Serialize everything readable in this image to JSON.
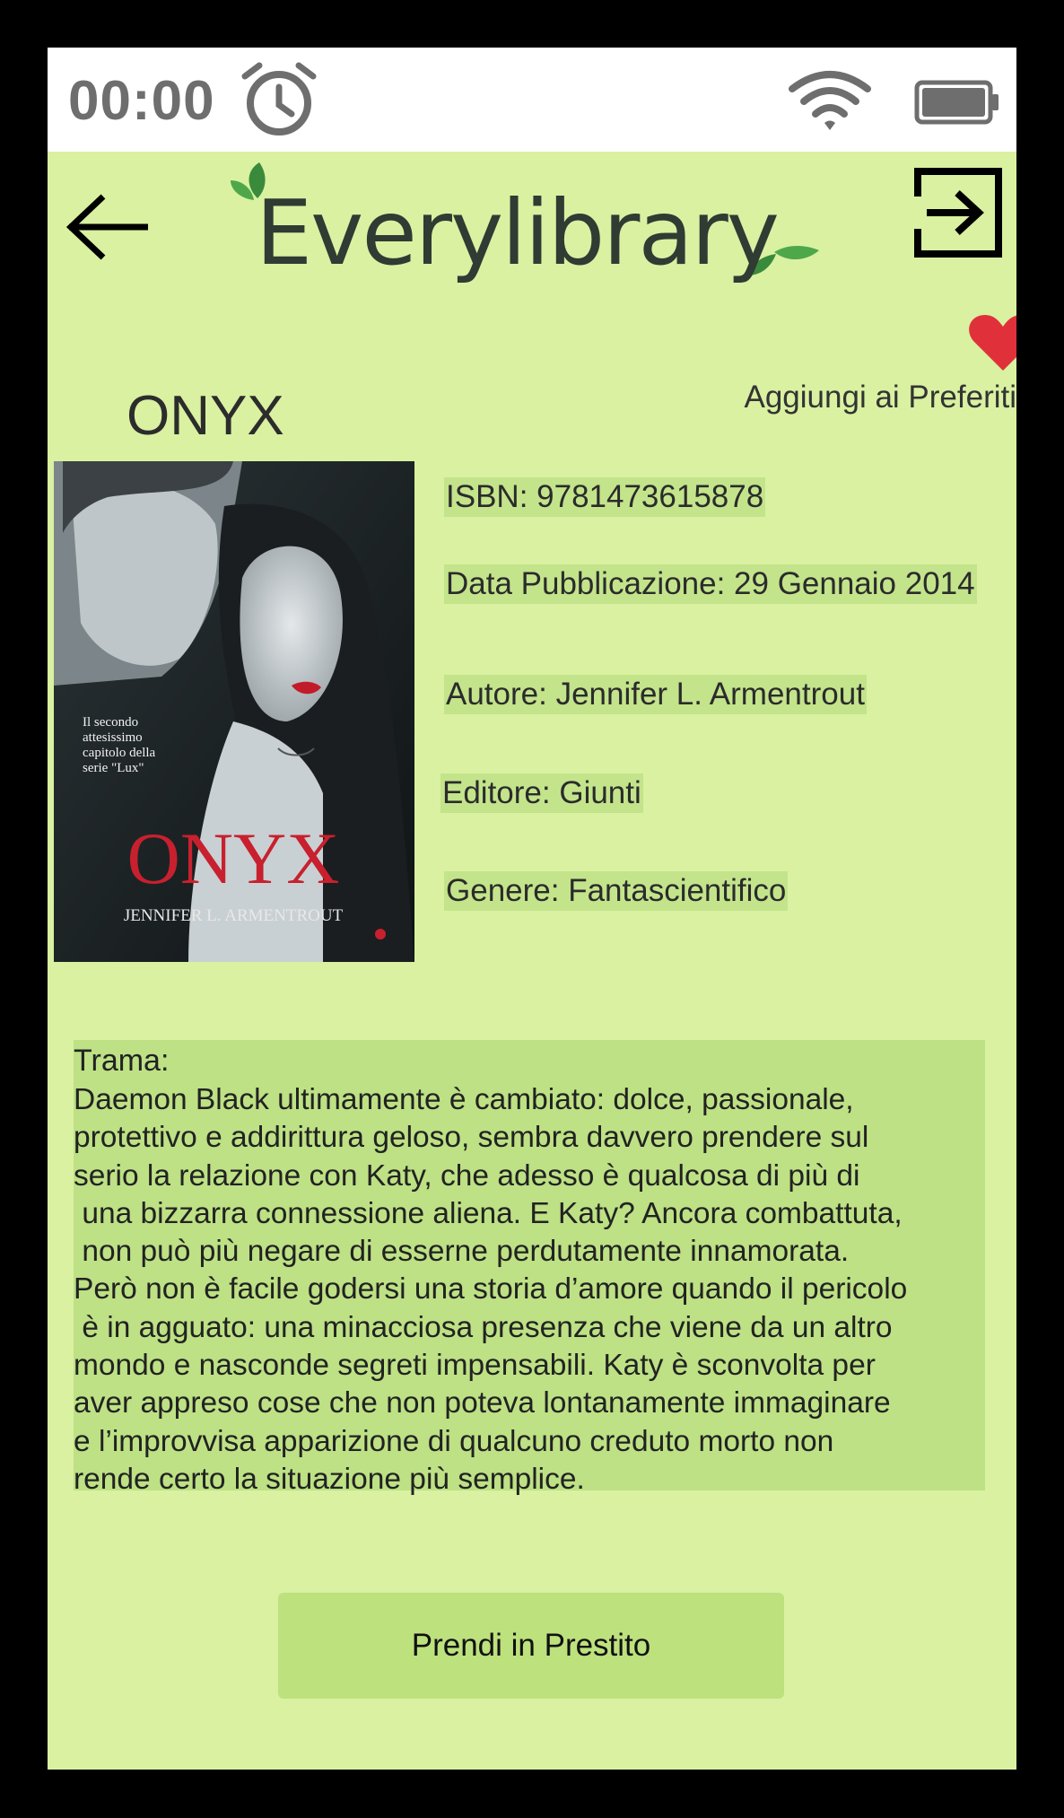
{
  "status": {
    "time": "00:00"
  },
  "header": {
    "logo_text": "Everylibrary"
  },
  "favorite": {
    "label": "Aggiungi ai Preferiti"
  },
  "book": {
    "title": "ONYX",
    "cover": {
      "tagline": "Il secondo\nattesissimo\ncapitolo della\nserie \"Lux\"",
      "title": "ONYX",
      "author": "JENNIFER L. ARMENTROUT"
    },
    "isbn": "ISBN: 9781473615878",
    "published": "Data Pubblicazione: 29 Gennaio 2014",
    "author": "Autore: Jennifer L. Armentrout",
    "publisher": "Editore: Giunti",
    "genre": "Genere: Fantascientifico"
  },
  "plot": {
    "label": "Trama:",
    "text": "Daemon Black ultimamente è cambiato: dolce, passionale,\nprotettivo e addirittura geloso, sembra davvero prendere sul\nserio la relazione con Katy, che adesso è qualcosa di più di\n una bizzarra connessione aliena. E Katy? Ancora combattuta,\n non può più negare di esserne perdutamente innamorata.\nPerò non è facile godersi una storia d’amore quando il pericolo\n è in agguato: una minacciosa presenza che viene da un altro\nmondo e nasconde segreti impensabili. Katy è sconvolta per\naver appreso cose che non poteva lontanamente immaginare\ne l’improvvisa apparizione di qualcuno creduto morto non\nrende certo la situazione più semplice."
  },
  "actions": {
    "loan_label": "Prendi in Prestito"
  },
  "colors": {
    "screen_bg": "#d9f1a1",
    "accent": "#bde184",
    "heart": "#e0313b"
  }
}
